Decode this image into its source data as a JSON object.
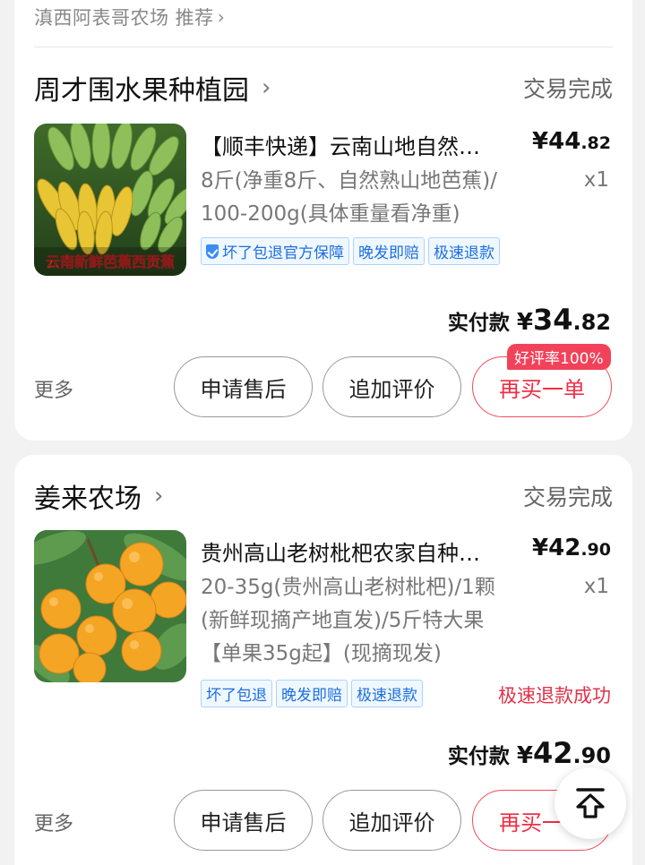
{
  "recommend": {
    "text": "滇西阿表哥农场 推荐",
    "chevron": "chevron-right-icon"
  },
  "orders": [
    {
      "shop_name": "周才围水果种植园",
      "status": "交易完成",
      "title": "【顺丰快递】云南山地自然熟西贡蕉",
      "title_display": "【顺丰快递】云南山地自然…",
      "unit_price": {
        "yen": "¥",
        "int": "44",
        "dec": ".82"
      },
      "spec_lines": [
        "8斤(净重8斤、自然熟山地芭蕉)/",
        "100-200g(具体重量看净重)"
      ],
      "qty": "x1",
      "image_caption": "云南新鲜芭蕉西贡蕉",
      "tags": [
        "坏了包退官方保障",
        "晚发即赔",
        "极速退款"
      ],
      "paid": {
        "label": "实付款",
        "yen": "¥",
        "int": "34",
        "dec": ".82"
      },
      "more": "更多",
      "buttons": {
        "after_sale": "申请售后",
        "add_review": "追加评价",
        "rebuy": "再买一单"
      },
      "rebuy_badge": "好评率100%"
    },
    {
      "shop_name": "姜来农场",
      "status": "交易完成",
      "title_display": "贵州高山老树枇杷农家自种…",
      "unit_price": {
        "yen": "¥",
        "int": "42",
        "dec": ".90"
      },
      "spec_lines": [
        "20-35g(贵州高山老树枇杷)/1颗",
        "(新鲜现摘产地直发)/5斤特大果",
        "【单果35g起】(现摘现发)"
      ],
      "qty": "x1",
      "tags": [
        "坏了包退",
        "晚发即赔",
        "极速退款"
      ],
      "refund_status": "极速退款成功",
      "paid": {
        "label": "实付款",
        "yen": "¥",
        "int": "42",
        "dec": ".90"
      },
      "more": "更多",
      "buttons": {
        "after_sale": "申请售后",
        "add_review": "追加评价",
        "rebuy": "再买一单"
      }
    }
  ],
  "fab": {
    "icon": "back-to-top-icon"
  },
  "colors": {
    "accent": "#ef2f45",
    "tag_blue": "#1d6fe0",
    "badge": "#f2425a"
  }
}
